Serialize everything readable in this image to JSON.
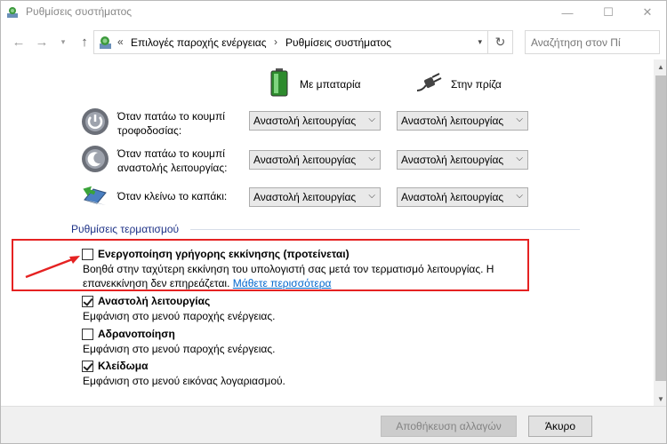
{
  "window": {
    "title": "Ρυθμίσεις συστήματος",
    "min": "—",
    "max": "☐",
    "close": "✕"
  },
  "nav": {
    "back": "←",
    "forward": "→",
    "down": "▾",
    "up": "↑",
    "refresh": "↻"
  },
  "breadcrumb": {
    "overflow": "«",
    "items": [
      "Επιλογές παροχής ενέργειας",
      "Ρυθμίσεις συστήματος"
    ],
    "sep": "›",
    "dropdown": "▾"
  },
  "search": {
    "placeholder": "Αναζήτηση στον Πί"
  },
  "columns": {
    "battery": "Με μπαταρία",
    "plugged": "Στην πρίζα"
  },
  "power_rows": [
    {
      "label": "Όταν πατάω το κουμπί τροφοδοσίας:",
      "battery": "Αναστολή λειτουργίας",
      "plugged": "Αναστολή λειτουργίας"
    },
    {
      "label": "Όταν πατάω το κουμπί αναστολής λειτουργίας:",
      "battery": "Αναστολή λειτουργίας",
      "plugged": "Αναστολή λειτουργίας"
    },
    {
      "label": "Όταν κλείνω το καπάκι:",
      "battery": "Αναστολή λειτουργίας",
      "plugged": "Αναστολή λειτουργίας"
    }
  ],
  "shutdown": {
    "title": "Ρυθμίσεις τερματισμού",
    "options": [
      {
        "title": "Ενεργοποίηση γρήγορης εκκίνησης (προτείνεται)",
        "checked": false,
        "desc1": "Βοηθά στην ταχύτερη εκκίνηση του υπολογιστή σας μετά τον τερματισμό λειτουργίας. Η",
        "desc2": "επανεκκίνηση δεν επηρεάζεται.",
        "link": "Μάθετε περισσότερα"
      },
      {
        "title": "Αναστολή λειτουργίας",
        "checked": true,
        "desc1": "Εμφάνιση στο μενού παροχής ενέργειας."
      },
      {
        "title": "Αδρανοποίηση",
        "checked": false,
        "desc1": "Εμφάνιση στο μενού παροχής ενέργειας."
      },
      {
        "title": "Κλείδωμα",
        "checked": true,
        "desc1": "Εμφάνιση στο μενού εικόνας λογαριασμού."
      }
    ]
  },
  "footer": {
    "save": "Αποθήκευση αλλαγών",
    "cancel": "Άκυρο"
  },
  "colors": {
    "highlight": "#e52222",
    "link": "#0066cc",
    "section": "#1e3287"
  }
}
